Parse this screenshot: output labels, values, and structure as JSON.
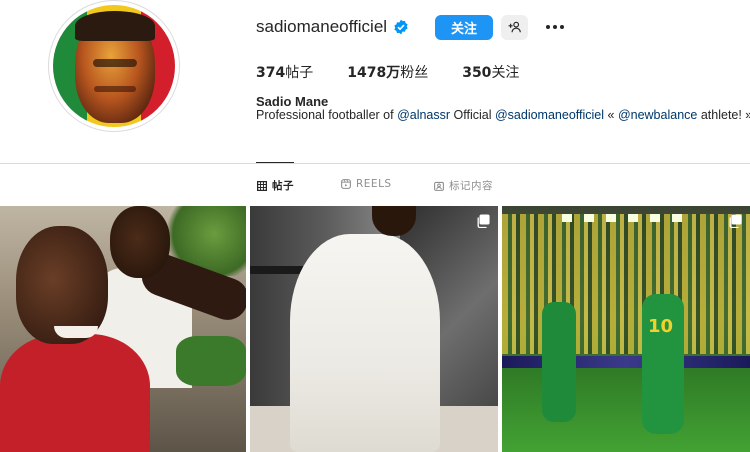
{
  "profile": {
    "username": "sadiomaneofficiel",
    "follow_label": "关注",
    "stats": {
      "posts_count": "374",
      "posts_label": "帖子",
      "followers_count": "1478万",
      "followers_label": "粉丝",
      "following_count": "350",
      "following_label": "关注"
    },
    "full_name": "Sadio Mane",
    "bio": {
      "prefix": "Professional footballer of ",
      "tag1": "@alnassr",
      "middle": " Official ",
      "tag2": "@sadiomaneofficiel",
      "sep": " «  ",
      "tag3": "@newbalance",
      "suffix": " athlete! »"
    }
  },
  "tabs": [
    {
      "label": "帖子",
      "icon": "grid-icon",
      "active": true
    },
    {
      "label": "REELS",
      "icon": "reels-icon",
      "active": false
    },
    {
      "label": "标记内容",
      "icon": "tagged-icon",
      "active": false
    }
  ],
  "posts": [
    {
      "kind": "photo",
      "multi": false
    },
    {
      "kind": "photo",
      "multi": true
    },
    {
      "kind": "photo",
      "multi": true,
      "jersey_number": "10"
    }
  ],
  "colors": {
    "follow_button": "#1e95f5",
    "verified_badge": "#0095f6",
    "tag_link": "#00376b"
  }
}
